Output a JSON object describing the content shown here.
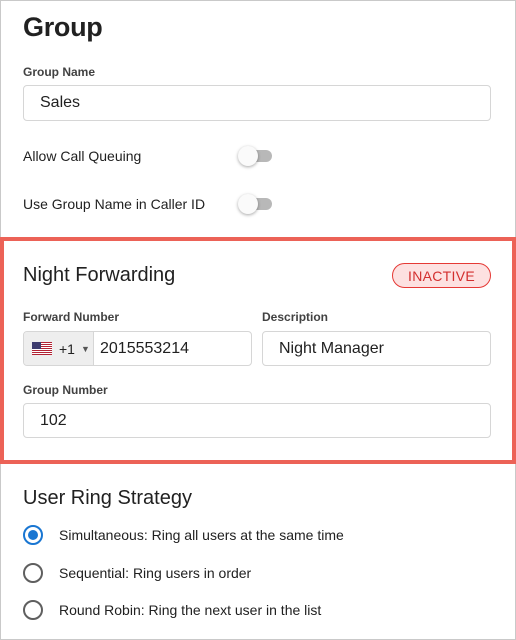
{
  "page": {
    "title": "Group"
  },
  "group_name": {
    "label": "Group Name",
    "value": "Sales"
  },
  "toggles": [
    {
      "label": "Allow Call Queuing",
      "on": false
    },
    {
      "label": "Use Group Name in Caller ID",
      "on": false
    }
  ],
  "night_forwarding": {
    "title": "Night Forwarding",
    "status": "INACTIVE",
    "highlight_color": "#ec6257",
    "forward_number": {
      "label": "Forward Number",
      "country_flag": "us-flag-icon",
      "country_code": "+1",
      "number": "2015553214"
    },
    "description": {
      "label": "Description",
      "value": "Night Manager"
    },
    "group_number": {
      "label": "Group Number",
      "value": "102"
    }
  },
  "ring_strategy": {
    "title": "User Ring Strategy",
    "accent_color": "#1976d2",
    "options": [
      {
        "label": "Simultaneous: Ring all users at the same time",
        "selected": true
      },
      {
        "label": "Sequential: Ring users in order",
        "selected": false
      },
      {
        "label": "Round Robin: Ring the next user in the list",
        "selected": false
      }
    ]
  }
}
